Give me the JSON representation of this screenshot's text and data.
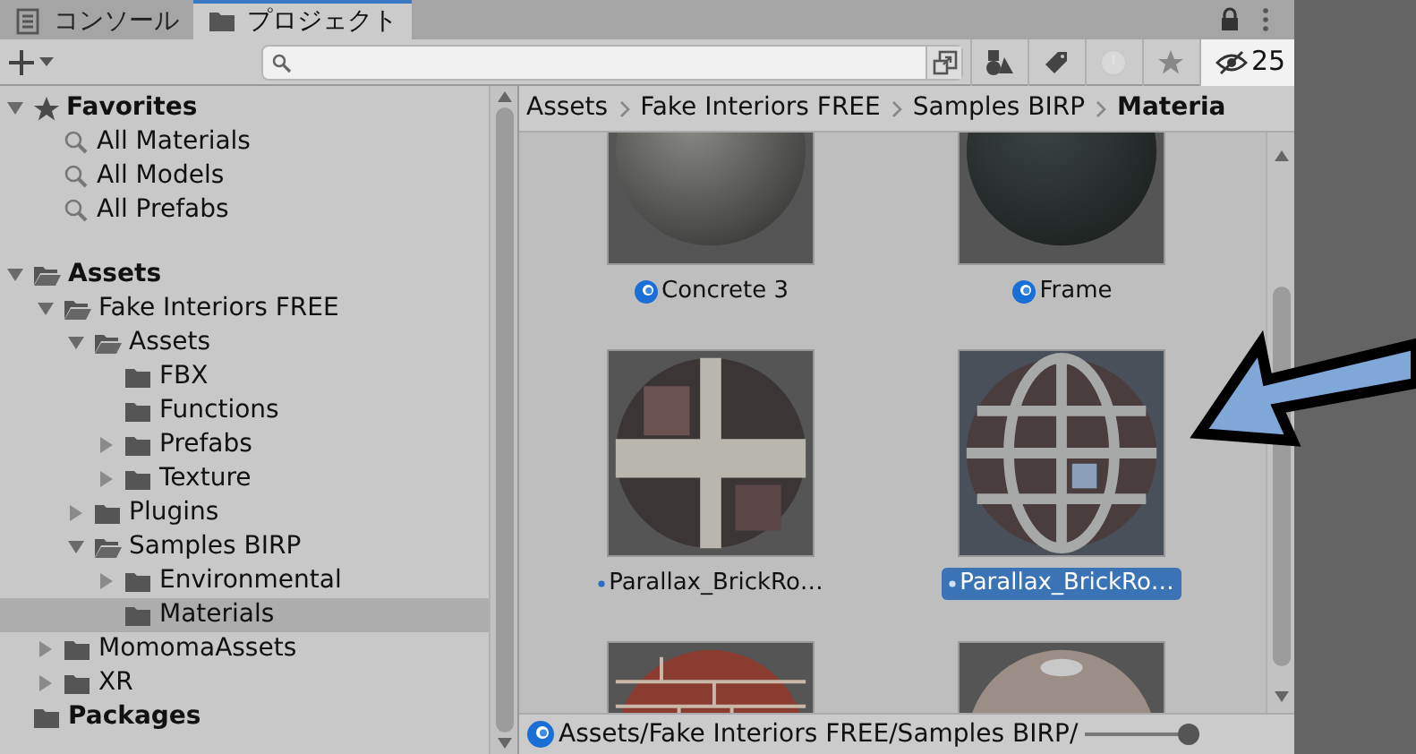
{
  "tabs": [
    {
      "label": "コンソール",
      "selected": false
    },
    {
      "label": "プロジェクト",
      "selected": true
    }
  ],
  "toolbar": {
    "hidden_count": "25"
  },
  "tree": [
    {
      "label": "Favorites",
      "kind": "favorites",
      "expanded": true,
      "selected": false,
      "children": [
        {
          "label": "All Materials",
          "kind": "search",
          "selected": false
        },
        {
          "label": "All Models",
          "kind": "search",
          "selected": false
        },
        {
          "label": "All Prefabs",
          "kind": "search",
          "selected": false
        }
      ]
    },
    {
      "label": "Assets",
      "kind": "folder",
      "expanded": true,
      "selected": false,
      "children": [
        {
          "label": "Fake Interiors FREE",
          "kind": "folder",
          "expanded": true,
          "selected": false,
          "children": [
            {
              "label": "Assets",
              "kind": "folder",
              "expanded": true,
              "selected": false,
              "children": [
                {
                  "label": "FBX",
                  "kind": "folder",
                  "selected": false
                },
                {
                  "label": "Functions",
                  "kind": "folder",
                  "selected": false
                },
                {
                  "label": "Prefabs",
                  "kind": "folder",
                  "expanded": false,
                  "selected": false
                },
                {
                  "label": "Texture",
                  "kind": "folder",
                  "expanded": false,
                  "selected": false
                }
              ]
            },
            {
              "label": "Plugins",
              "kind": "folder",
              "expanded": false,
              "selected": false
            },
            {
              "label": "Samples BIRP",
              "kind": "folder",
              "expanded": true,
              "selected": false,
              "children": [
                {
                  "label": "Environmental",
                  "kind": "folder",
                  "expanded": false,
                  "selected": false
                },
                {
                  "label": "Materials",
                  "kind": "folder",
                  "selected": true
                }
              ]
            }
          ]
        },
        {
          "label": "MomomaAssets",
          "kind": "folder",
          "expanded": false,
          "selected": false
        },
        {
          "label": "XR",
          "kind": "folder",
          "expanded": false,
          "selected": false
        }
      ]
    },
    {
      "label": "Packages",
      "kind": "folder",
      "selected": false
    }
  ],
  "breadcrumb": [
    {
      "label": "Assets",
      "current": false
    },
    {
      "label": "Fake Interiors FREE",
      "current": false
    },
    {
      "label": "Samples BIRP",
      "current": false
    },
    {
      "label": "Materia",
      "current": true
    }
  ],
  "grid": [
    {
      "label": "Concrete 3",
      "kind": "material",
      "selected": false
    },
    {
      "label": "Frame",
      "kind": "material",
      "selected": false
    },
    {
      "label": "Parallax_BrickRo…",
      "kind": "variant",
      "selected": false
    },
    {
      "label": "Parallax_BrickRo…",
      "kind": "variant",
      "selected": true
    },
    {
      "kind": "picture"
    },
    {
      "kind": "picture"
    }
  ],
  "status_bar": {
    "path": "Assets/Fake Interiors FREE/Samples BIRP/",
    "zoom": {
      "level": 1
    }
  }
}
